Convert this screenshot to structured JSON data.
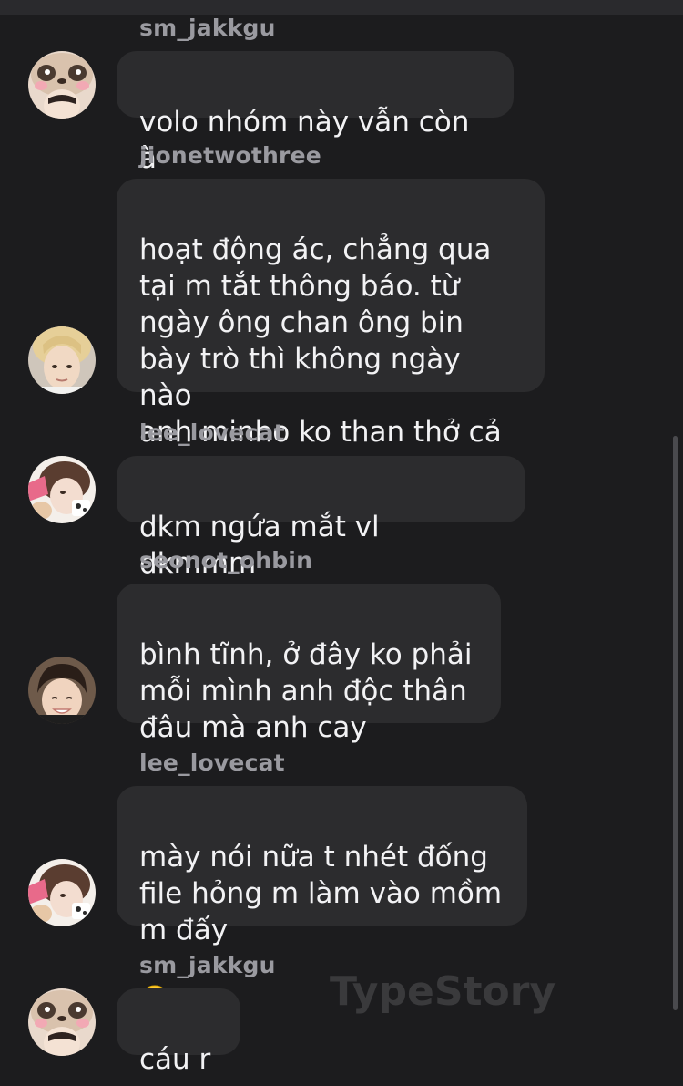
{
  "messages": [
    {
      "sender": "sm_jakkgu",
      "text": "volo nhóm này vẫn còn à",
      "avatar": "panda-avatar"
    },
    {
      "sender": "jionetwothree",
      "text": "hoạt động ác, chẳng qua\ntại m tắt thông báo. từ\nngày ông chan ông bin\nbày trò thì không ngày nào\nanh minho ko than thở cả",
      "avatar": "blond-avatar"
    },
    {
      "sender": "lee_lovecat",
      "text": "dkm ngứa mắt vl dkmmm",
      "avatar": "cat-avatar"
    },
    {
      "sender": "seonot_ohbin",
      "text": "bình tĩnh, ở đây ko phải\nmỗi mình anh độc thân\nđâu mà anh cay",
      "avatar": "dark-hair-avatar"
    },
    {
      "sender": "lee_lovecat",
      "text": "mày nói nữa t nhét đống\nfile hỏng m làm vào mồm\nm đấy",
      "emoji": "🙂",
      "avatar": "cat-avatar"
    },
    {
      "sender": "sm_jakkgu",
      "text": "cáu r",
      "avatar": "panda-avatar"
    }
  ],
  "watermark": "TypeStory",
  "colors": {
    "background": "#1c1c1e",
    "bubble": "#2c2c2e",
    "sender": "#9a9aa0",
    "text": "#f2f2f4"
  }
}
